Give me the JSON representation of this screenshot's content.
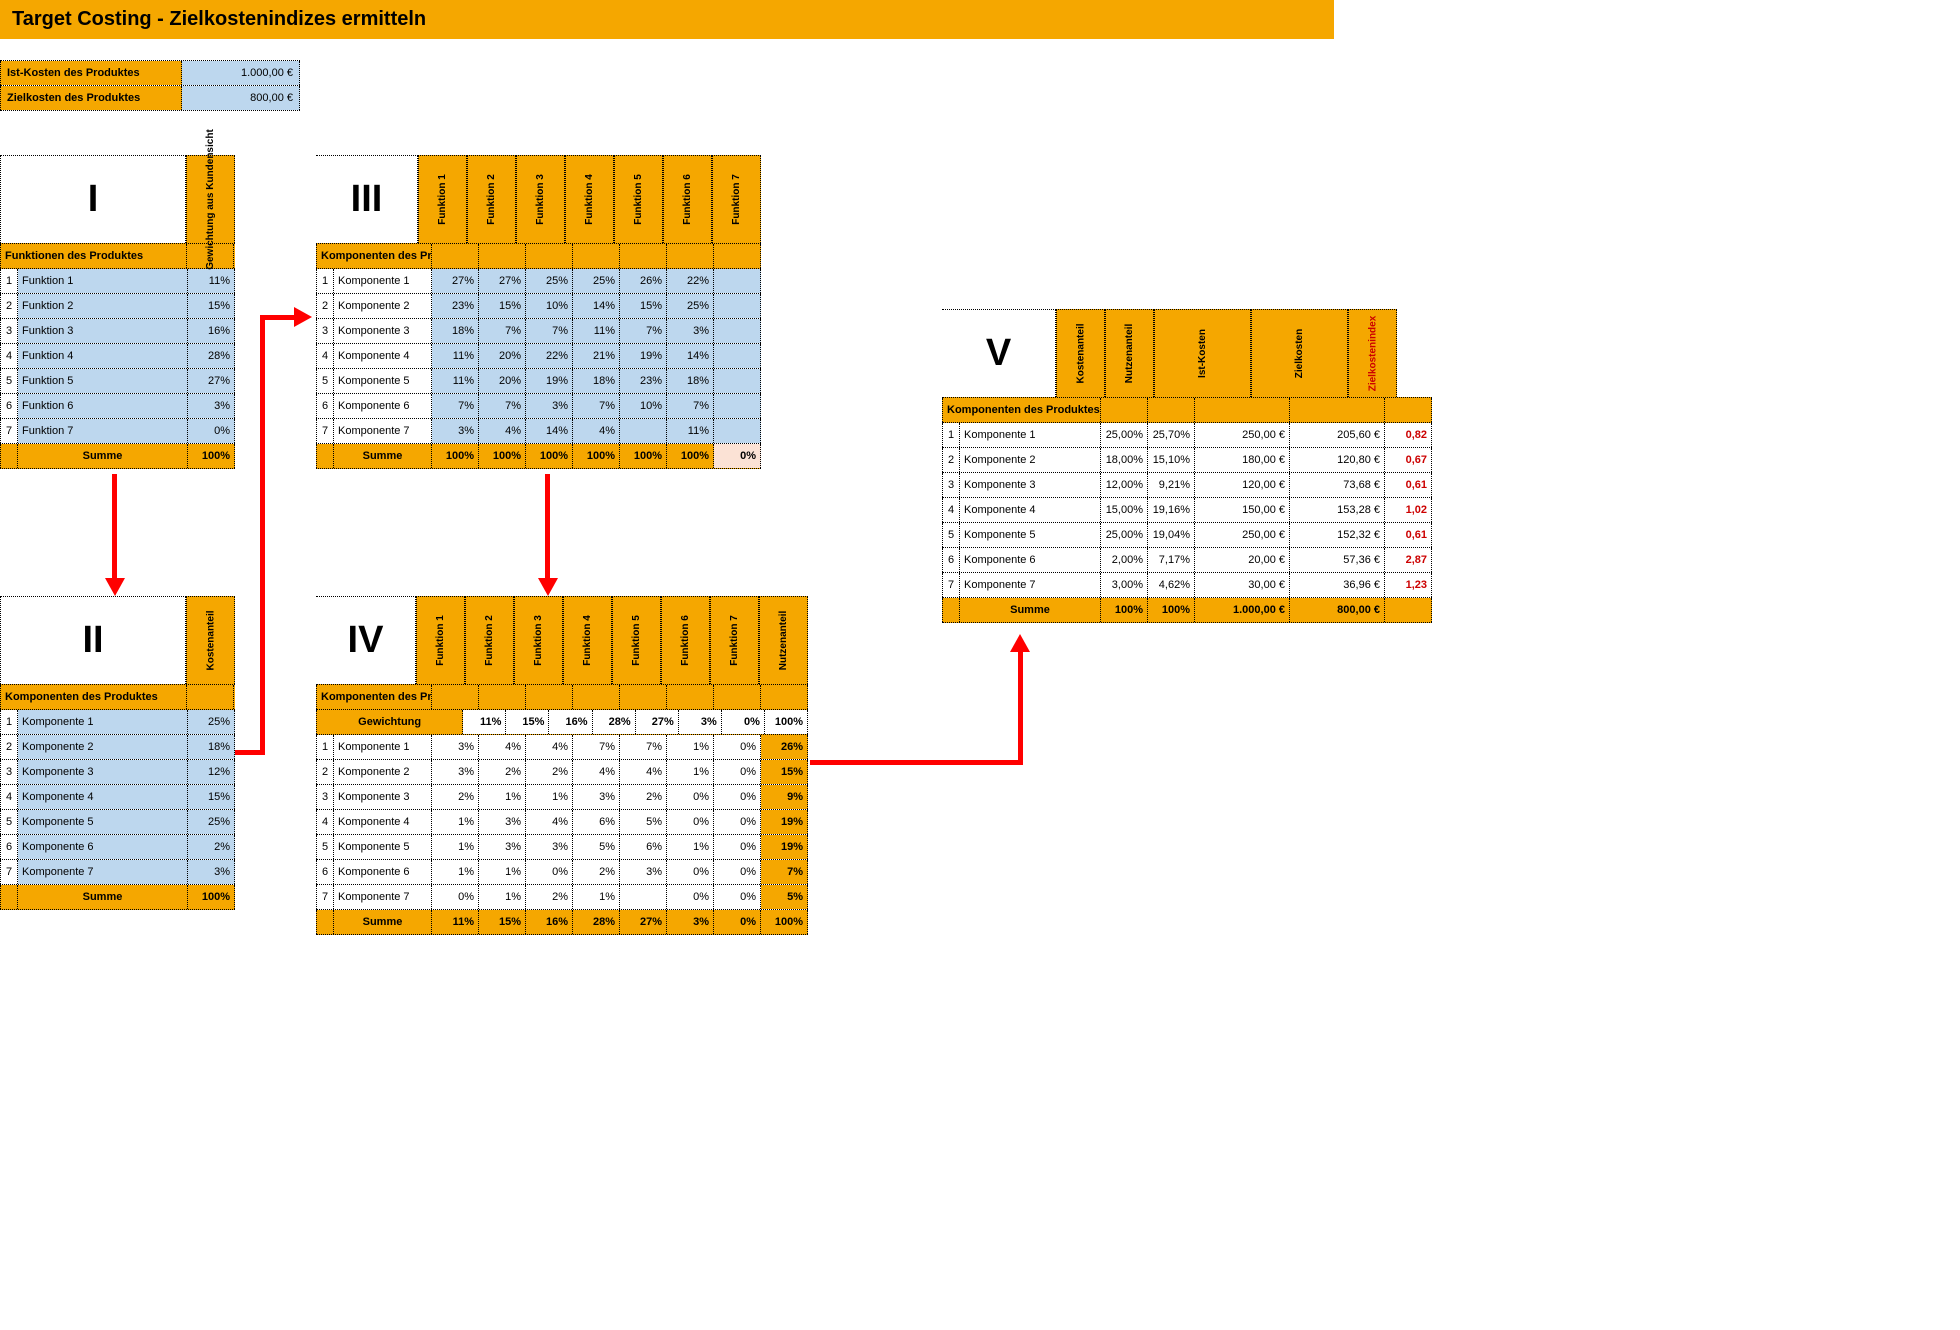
{
  "title": "Target Costing - Zielkostenindizes ermitteln",
  "summary": {
    "ist_label": "Ist-Kosten des Produktes",
    "ist_value": "1.000,00 €",
    "ziel_label": "Zielkosten des Produktes",
    "ziel_value": "800,00 €"
  },
  "block1": {
    "roman": "I",
    "vhead": "Gewichtung aus Kundensicht",
    "caption": "Funktionen des Produktes",
    "rows": [
      {
        "i": "1",
        "name": "Funktion 1",
        "v": "11%"
      },
      {
        "i": "2",
        "name": "Funktion 2",
        "v": "15%"
      },
      {
        "i": "3",
        "name": "Funktion 3",
        "v": "16%"
      },
      {
        "i": "4",
        "name": "Funktion 4",
        "v": "28%"
      },
      {
        "i": "5",
        "name": "Funktion 5",
        "v": "27%"
      },
      {
        "i": "6",
        "name": "Funktion 6",
        "v": "3%"
      },
      {
        "i": "7",
        "name": "Funktion 7",
        "v": "0%"
      }
    ],
    "sum_label": "Summe",
    "sum_value": "100%"
  },
  "block2": {
    "roman": "II",
    "vhead": "Kostenanteil",
    "caption": "Komponenten des Produktes",
    "rows": [
      {
        "i": "1",
        "name": "Komponente 1",
        "v": "25%"
      },
      {
        "i": "2",
        "name": "Komponente 2",
        "v": "18%"
      },
      {
        "i": "3",
        "name": "Komponente 3",
        "v": "12%"
      },
      {
        "i": "4",
        "name": "Komponente 4",
        "v": "15%"
      },
      {
        "i": "5",
        "name": "Komponente 5",
        "v": "25%"
      },
      {
        "i": "6",
        "name": "Komponente 6",
        "v": "2%"
      },
      {
        "i": "7",
        "name": "Komponente 7",
        "v": "3%"
      }
    ],
    "sum_label": "Summe",
    "sum_value": "100%"
  },
  "block3": {
    "roman": "III",
    "caption": "Komponenten des Produktes",
    "col_heads": [
      "Funktion 1",
      "Funktion 2",
      "Funktion 3",
      "Funktion 4",
      "Funktion 5",
      "Funktion 6",
      "Funktion 7"
    ],
    "rows": [
      {
        "i": "1",
        "name": "Komponente 1",
        "v": [
          "27%",
          "27%",
          "25%",
          "25%",
          "26%",
          "22%",
          ""
        ]
      },
      {
        "i": "2",
        "name": "Komponente 2",
        "v": [
          "23%",
          "15%",
          "10%",
          "14%",
          "15%",
          "25%",
          ""
        ]
      },
      {
        "i": "3",
        "name": "Komponente 3",
        "v": [
          "18%",
          "7%",
          "7%",
          "11%",
          "7%",
          "3%",
          ""
        ]
      },
      {
        "i": "4",
        "name": "Komponente 4",
        "v": [
          "11%",
          "20%",
          "22%",
          "21%",
          "19%",
          "14%",
          ""
        ]
      },
      {
        "i": "5",
        "name": "Komponente 5",
        "v": [
          "11%",
          "20%",
          "19%",
          "18%",
          "23%",
          "18%",
          ""
        ]
      },
      {
        "i": "6",
        "name": "Komponente 6",
        "v": [
          "7%",
          "7%",
          "3%",
          "7%",
          "10%",
          "7%",
          ""
        ]
      },
      {
        "i": "7",
        "name": "Komponente 7",
        "v": [
          "3%",
          "4%",
          "14%",
          "4%",
          "",
          "11%",
          ""
        ]
      }
    ],
    "sum_label": "Summe",
    "sum_row": [
      "100%",
      "100%",
      "100%",
      "100%",
      "100%",
      "100%",
      "0%"
    ]
  },
  "block4": {
    "roman": "IV",
    "caption": "Komponenten des Produktes",
    "col_heads": [
      "Funktion 1",
      "Funktion 2",
      "Funktion 3",
      "Funktion 4",
      "Funktion 5",
      "Funktion 6",
      "Funktion 7",
      "Nutzenanteil"
    ],
    "weight_label": "Gewichtung",
    "weight_row": [
      "11%",
      "15%",
      "16%",
      "28%",
      "27%",
      "3%",
      "0%",
      "100%"
    ],
    "rows": [
      {
        "i": "1",
        "name": "Komponente 1",
        "v": [
          "3%",
          "4%",
          "4%",
          "7%",
          "7%",
          "1%",
          "0%"
        ],
        "n": "26%"
      },
      {
        "i": "2",
        "name": "Komponente 2",
        "v": [
          "3%",
          "2%",
          "2%",
          "4%",
          "4%",
          "1%",
          "0%"
        ],
        "n": "15%"
      },
      {
        "i": "3",
        "name": "Komponente 3",
        "v": [
          "2%",
          "1%",
          "1%",
          "3%",
          "2%",
          "0%",
          "0%"
        ],
        "n": "9%"
      },
      {
        "i": "4",
        "name": "Komponente 4",
        "v": [
          "1%",
          "3%",
          "4%",
          "6%",
          "5%",
          "0%",
          "0%"
        ],
        "n": "19%"
      },
      {
        "i": "5",
        "name": "Komponente 5",
        "v": [
          "1%",
          "3%",
          "3%",
          "5%",
          "6%",
          "1%",
          "0%"
        ],
        "n": "19%"
      },
      {
        "i": "6",
        "name": "Komponente 6",
        "v": [
          "1%",
          "1%",
          "0%",
          "2%",
          "3%",
          "0%",
          "0%"
        ],
        "n": "7%"
      },
      {
        "i": "7",
        "name": "Komponente 7",
        "v": [
          "0%",
          "1%",
          "2%",
          "1%",
          "",
          "0%",
          "0%"
        ],
        "n": "5%"
      }
    ],
    "sum_label": "Summe",
    "sum_row": [
      "11%",
      "15%",
      "16%",
      "28%",
      "27%",
      "3%",
      "0%",
      "100%"
    ]
  },
  "block5": {
    "roman": "V",
    "caption": "Komponenten des Produktes",
    "col_heads": [
      "Kostenanteil",
      "Nutzenanteil",
      "Ist-Kosten",
      "Zielkosten",
      "Zielkostenindex"
    ],
    "rows": [
      {
        "i": "1",
        "name": "Komponente 1",
        "v": [
          "25,00%",
          "25,70%",
          "250,00 €",
          "205,60 €",
          "0,82"
        ]
      },
      {
        "i": "2",
        "name": "Komponente 2",
        "v": [
          "18,00%",
          "15,10%",
          "180,00 €",
          "120,80 €",
          "0,67"
        ]
      },
      {
        "i": "3",
        "name": "Komponente 3",
        "v": [
          "12,00%",
          "9,21%",
          "120,00 €",
          "73,68 €",
          "0,61"
        ]
      },
      {
        "i": "4",
        "name": "Komponente 4",
        "v": [
          "15,00%",
          "19,16%",
          "150,00 €",
          "153,28 €",
          "1,02"
        ]
      },
      {
        "i": "5",
        "name": "Komponente 5",
        "v": [
          "25,00%",
          "19,04%",
          "250,00 €",
          "152,32 €",
          "0,61"
        ]
      },
      {
        "i": "6",
        "name": "Komponente 6",
        "v": [
          "2,00%",
          "7,17%",
          "20,00 €",
          "57,36 €",
          "2,87"
        ]
      },
      {
        "i": "7",
        "name": "Komponente 7",
        "v": [
          "3,00%",
          "4,62%",
          "30,00 €",
          "36,96 €",
          "1,23"
        ]
      }
    ],
    "sum_label": "Summe",
    "sum_row": [
      "100%",
      "100%",
      "1.000,00 €",
      "800,00 €",
      ""
    ]
  }
}
